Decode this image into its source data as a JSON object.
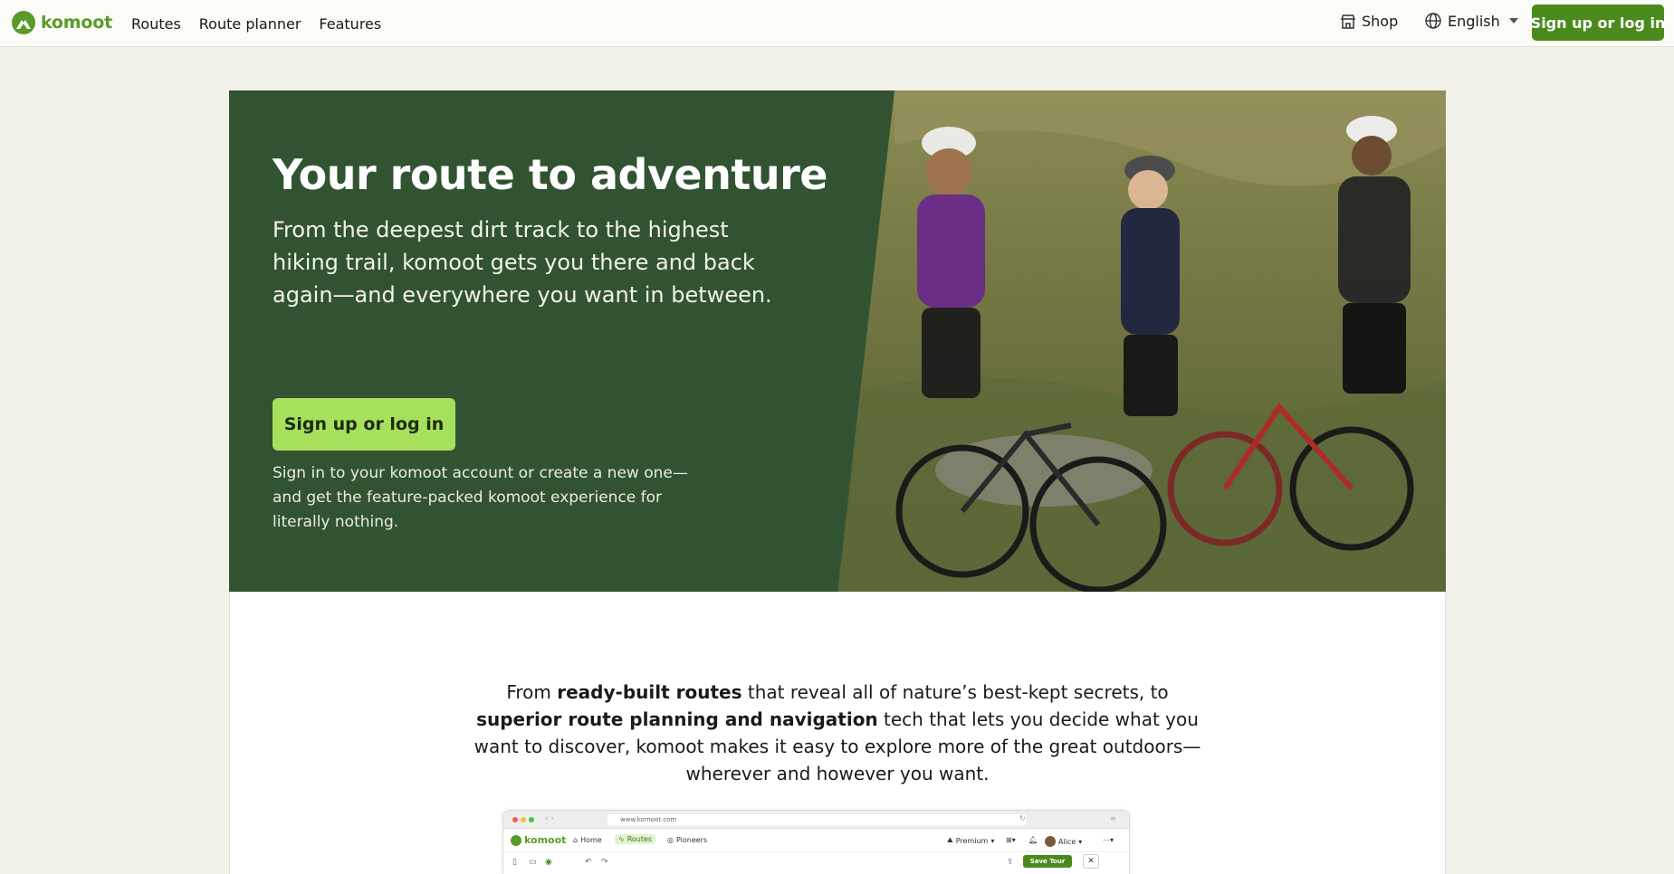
{
  "header": {
    "brand": "komoot",
    "nav": [
      {
        "label": "Routes"
      },
      {
        "label": "Route planner"
      },
      {
        "label": "Features"
      }
    ],
    "shop_label": "Shop",
    "language_label": "English",
    "cta_label": "Sign up or log in"
  },
  "hero": {
    "title": "Your route to adventure",
    "subtitle": "From the deepest dirt track to the highest hiking trail, komoot gets you there and back again—and everywhere you want in between.",
    "button_label": "Sign up or log in",
    "note": "Sign in to your komoot account or create a new one—and get the feature-packed komoot experience for literally nothing."
  },
  "intro": {
    "p1": "From ",
    "b1": "ready-built routes",
    "p2": " that reveal all of nature’s best-kept secrets, to ",
    "b2": "superior route planning and navigation",
    "p3": " tech that lets you decide what you want to discover, komoot makes it easy to explore more of the great outdoors—wherever and however you want."
  },
  "preview": {
    "url": "www.komoot.com",
    "brand": "komoot",
    "home": "Home",
    "routes": "Routes",
    "pioneers": "Pioneers",
    "premium": "Premium",
    "user": "Alice",
    "save_tour": "Save Tour"
  },
  "colors": {
    "brand_green": "#4a8a1c",
    "hero_bg": "#325332",
    "hero_button": "#a6e05c",
    "page_bg": "#f2f1e9"
  }
}
